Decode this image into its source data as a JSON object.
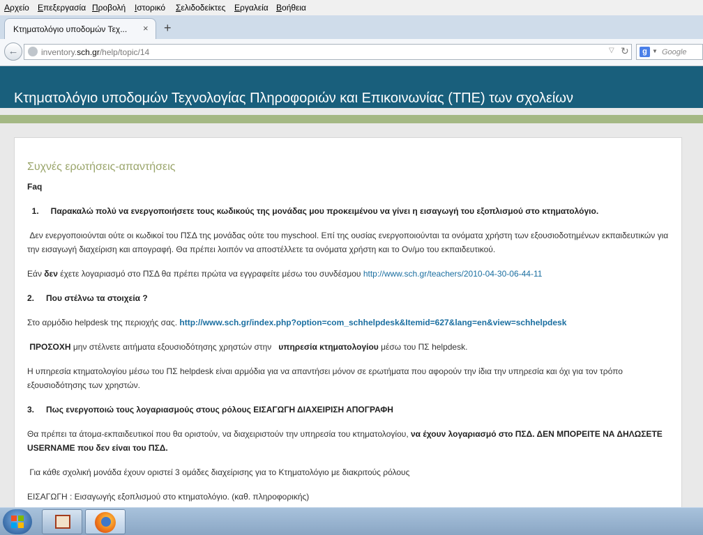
{
  "menu": [
    "Αρχείο",
    "Επεξεργασία",
    "Προβολή",
    "Ιστορικό",
    "Σελιδοδείκτες",
    "Εργαλεία",
    "Βοήθεια"
  ],
  "tab": {
    "title": "Κτηματολόγιο υποδομών Τεχ...",
    "close": "×",
    "new_tab": "+"
  },
  "nav": {
    "url_prefix": "inventory.",
    "url_domain": "sch.gr",
    "url_path": "/help/topic/14",
    "search_engine": "g",
    "search_placeholder": "Google"
  },
  "site": {
    "title": "Κτηματολόγιο υποδομών Τεχνολογίας Πληροφοριών και Επικοινωνίας (ΤΠΕ) των σχολείων"
  },
  "faq": {
    "heading": "Συχνές ερωτήσεις-απαντήσεις",
    "label": "Faq",
    "q1_num": "1.",
    "q1": "Παρακαλώ πολύ να ενεργοποιήσετε τους κωδικούς της μονάδας μου προκειμένου να γίνει η εισαγωγή του εξοπλισμού στο κτηματολόγιο.",
    "a1_p1": "Δεν ενεργοποιούνται ούτε οι κωδικοί του ΠΣΔ της μονάδας ούτε του myschool. Επί της ουσίας ενεργοποιούνται τα ονόματα χρήστη των εξουσιοδοτημένων εκπαιδευτικών για την εισαγωγή διαχείριση και απογραφή. Θα πρέπει λοιπόν να αποστέλλετε τα ονόματα χρήστη και το Ον/μο του εκπαιδευτικού.",
    "a1_p2_a": "Εάν ",
    "a1_p2_bold": "δεν",
    "a1_p2_b": " έχετε λογαριασμό στο ΠΣΔ θα πρέπει πρώτα να εγγραφείτε μέσω του συνδέσμου ",
    "a1_link": "http://www.sch.gr/teachers/2010-04-30-06-44-11",
    "q2_num": "2.",
    "q2": "Που στέλνω τα στοιχεία ?",
    "a2_text": "Στο αρμόδιο helpdesk της περιοχής σας. ",
    "a2_link": "http://www.sch.gr/index.php?option=com_schhelpdesk&Itemid=627&lang=en&view=schhelpdesk",
    "a2_warn_bold": "ΠΡΟΣΟΧΗ",
    "a2_warn_a": " μην στέλνετε αιτήματα εξουσιοδότησης χρηστών στην ",
    "a2_warn_bold2": "υπηρεσία κτηματολογίου",
    "a2_warn_b": " μέσω του ΠΣ helpdesk.",
    "a2_p3": "Η υπηρεσία κτηματολογίου μέσω του ΠΣ helpdesk είναι αρμόδια για να απαντήσει μόνον σε ερωτήματα που αφορούν την ίδια την υπηρεσία και όχι για τον τρόπο εξουσιοδότησης των χρηστών.",
    "q3_num": "3.",
    "q3": "Πως  ενεργοποιώ τους λογαριασμούς στους ρόλους ΕΙΣΑΓΩΓΗ ΔΙΑΧΕΙΡΙΣΗ ΑΠΟΓΡΑΦΗ",
    "a3_p1_a": "Θα πρέπει τα άτομα-εκπαιδευτικοί που θα οριστούν, να διαχειριστούν την υπηρεσία του κτηματολογίου, ",
    "a3_p1_bold": "να έχουν λογαριασμό στο ΠΣΔ. ΔΕΝ ΜΠΟΡΕΙΤΕ ΝΑ ΔΗΛΩΣΕΤΕ USERNAME που δεν είναι του ΠΣΔ.",
    "a3_p2": "Για κάθε σχολική μονάδα έχουν οριστεί 3 ομάδες διαχείρισης για το Κτηματολόγιο με διακριτούς ρόλους",
    "a3_p3": "ΕΙΣΑΓΩΓΗ : Εισαγωγής εξοπλισμού στο κτηματολόγιο. (καθ. πληροφορικής)"
  },
  "taskbar": {
    "items": [
      "start-button",
      "presentation-app",
      "firefox"
    ]
  }
}
